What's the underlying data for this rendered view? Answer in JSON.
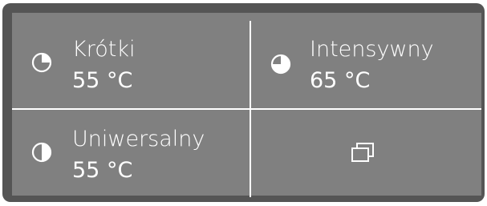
{
  "programs": [
    {
      "name": "Krótki",
      "temp": "55 °C",
      "icon": "pie-quarter-icon"
    },
    {
      "name": "Intensywny",
      "temp": "65 °C",
      "icon": "pie-three-quarter-icon"
    },
    {
      "name": "Uniwersalny",
      "temp": "55 °C",
      "icon": "pie-half-icon"
    }
  ],
  "more_button": {
    "icon": "overlapping-windows-icon"
  },
  "colors": {
    "frame": "#555555",
    "panel": "#808080",
    "foreground": "#ffffff"
  }
}
